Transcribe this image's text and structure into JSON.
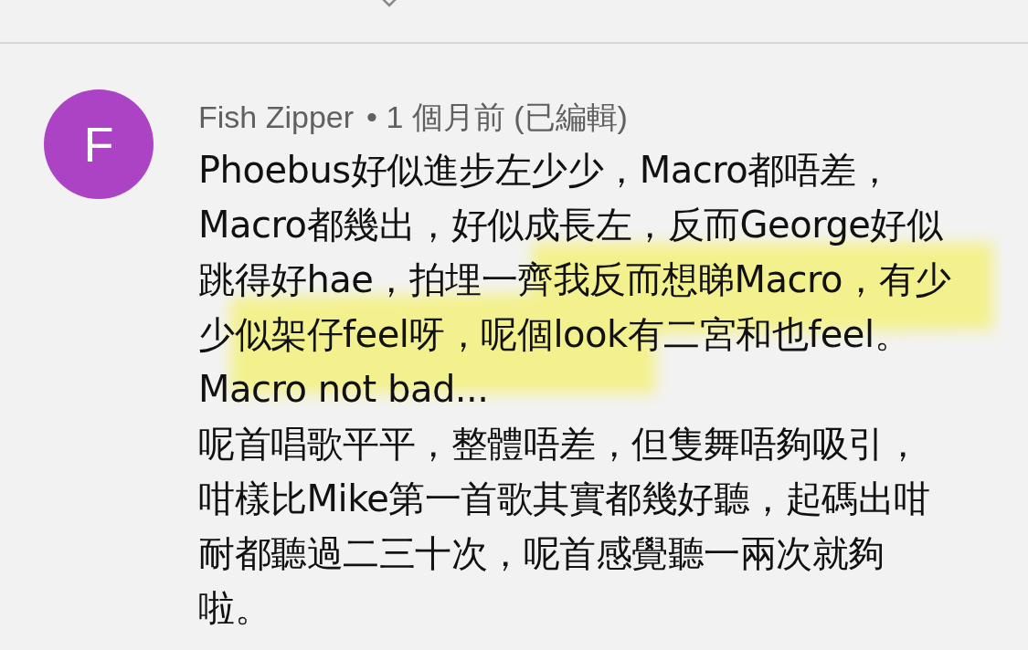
{
  "comment": {
    "avatar_letter": "F",
    "author": "Fish Zipper",
    "meta": "• 1 個月前 (已編輯)",
    "lines": [
      "Phoebus好似進步左少少，Macro都唔差，",
      "Macro都幾出，好似成長左，反而George好似",
      "跳得好hae，拍埋一齊我反而想睇Macro，有少",
      "少似架仔feel呀，呢個look有二宮和也feel。",
      "Macro not bad...",
      "呢首唱歌平平，整體唔差，但隻舞唔夠吸引，",
      "咁樣比Mike第一首歌其實都幾好聽，起碼出咁",
      "耐都聽過二三十次，呢首感覺聽一兩次就夠",
      "啦。"
    ]
  }
}
